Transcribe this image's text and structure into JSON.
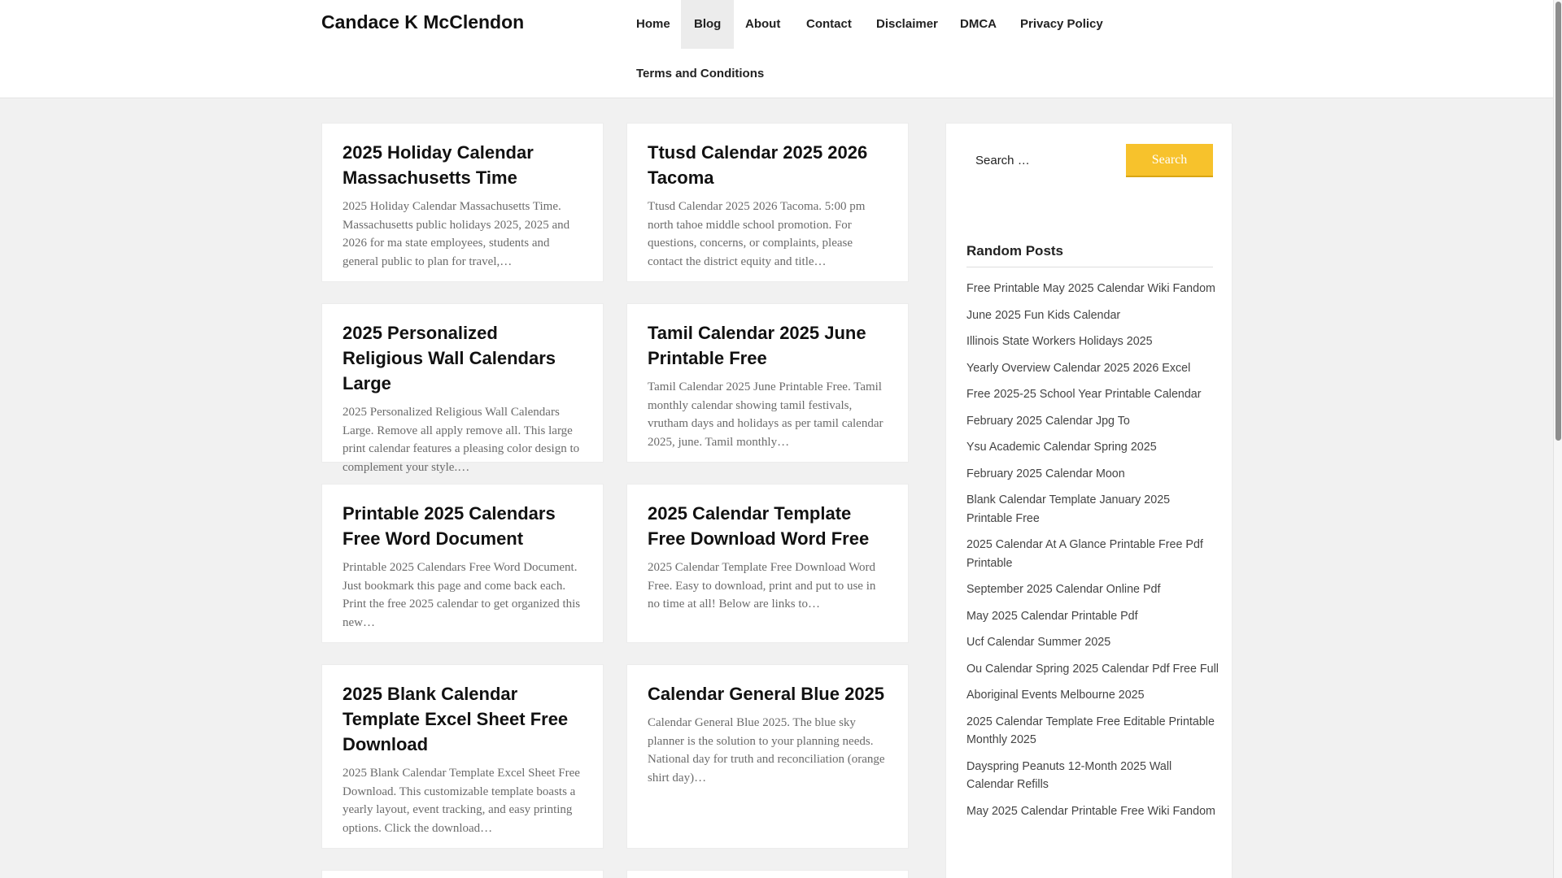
{
  "site": {
    "title": "Candace K McClendon"
  },
  "nav": {
    "items": [
      {
        "label": "Home"
      },
      {
        "label": "Blog"
      },
      {
        "label": "About"
      },
      {
        "label": "Contact"
      },
      {
        "label": "Disclaimer"
      },
      {
        "label": "DMCA"
      },
      {
        "label": "Privacy Policy"
      },
      {
        "label": "Terms and Conditions"
      }
    ],
    "active": "Blog"
  },
  "posts": [
    {
      "title": "2025 Holiday Calendar Massachusetts Time",
      "excerpt": "2025 Holiday Calendar Massachusetts Time. Massachusetts public holidays 2025, 2025 and 2026 for ma state employees, students and general public to plan for travel,…"
    },
    {
      "title": "Ttusd Calendar 2025 2026 Tacoma",
      "excerpt": "Ttusd Calendar 2025 2026 Tacoma. 5:00 pm north tahoe middle school promotion. For questions, concerns, or complaints, please contact the district equity and title…"
    },
    {
      "title": "2025 Personalized Religious Wall Calendars Large",
      "excerpt": "2025 Personalized Religious Wall Calendars Large. Remove all apply remove all. This large print calendar features a pleasing color design to complement your style.…"
    },
    {
      "title": "Tamil Calendar 2025 June Printable Free",
      "excerpt": "Tamil Calendar 2025 June Printable Free. Tamil monthly calendar showing tamil festivals, vrutham days and holidays as per tamil calendar 2025, june. Tamil monthly…"
    },
    {
      "title": "Printable 2025 Calendars Free Word Document",
      "excerpt": "Printable 2025 Calendars Free Word Document. Just bookmark this page and come back each. Print the free 2025 calendar to get organized this new…"
    },
    {
      "title": "2025 Calendar Template Free Download Word Free",
      "excerpt": "2025 Calendar Template Free Download Word Free. Easy to download, print and put to use in no time at all! Below are links to…"
    },
    {
      "title": "2025 Blank Calendar Template Excel Sheet Free Download",
      "excerpt": "2025 Blank Calendar Template Excel Sheet Free Download. This customizable template boasts a yearly layout, event tracking, and easy printing options. Click the download…"
    },
    {
      "title": "Calendar General Blue 2025",
      "excerpt": "Calendar General Blue 2025. The blue sky planner is the solution to your planning needs. National day for truth and reconciliation (orange shirt day)…"
    }
  ],
  "search": {
    "placeholder": "Search …",
    "button_label": "Search"
  },
  "sidebar": {
    "random_title": "Random Posts",
    "random_posts": [
      "Free Printable May 2025 Calendar Wiki Fandom",
      "June 2025 Fun Kids Calendar",
      "Illinois State Workers Holidays 2025",
      "Yearly Overview Calendar 2025 2026 Excel",
      "Free 2025-25 School Year Printable Calendar",
      "February 2025 Calendar Jpg To",
      "Ysu Academic Calendar Spring 2025",
      "February 2025 Calendar Moon",
      "Blank Calendar Template January 2025 Printable Free",
      "2025 Calendar At A Glance Printable Free Pdf Printable",
      "September 2025 Calendar Online Pdf",
      "May 2025 Calendar Printable Pdf",
      "Ucf Calendar Summer 2025",
      "Ou Calendar Spring 2025 Calendar Pdf Free Full",
      "Aboriginal Events Melbourne 2025",
      "2025 Calendar Template Free Editable Printable Monthly 2025",
      "Dayspring Peanuts 12-Month 2025 Wall Calendar Refills",
      "May 2025 Calendar Printable Free Wiki Fandom"
    ]
  },
  "colors": {
    "accent": "#f7c22c",
    "background": "#f1f1f1",
    "card": "#ffffff"
  }
}
